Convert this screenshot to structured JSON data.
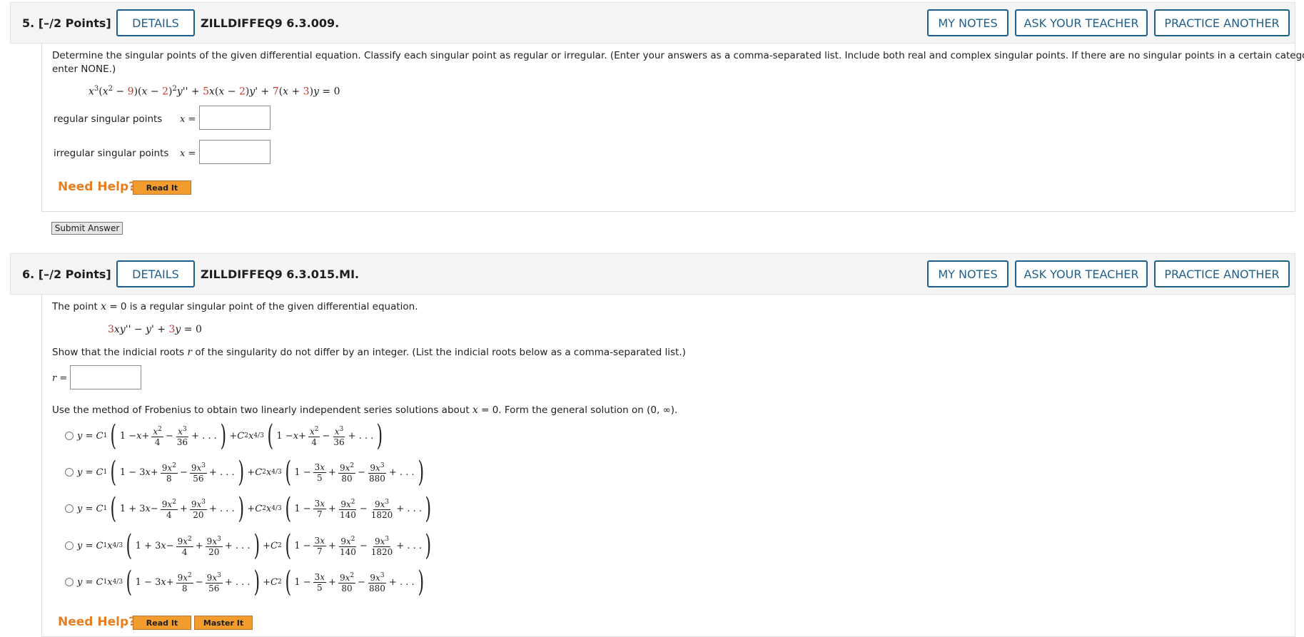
{
  "q5": {
    "number": "5.",
    "points": "[–/2 Points]",
    "details": "DETAILS",
    "id": "ZILLDIFFEQ9 6.3.009.",
    "my_notes": "MY NOTES",
    "ask_teacher": "ASK YOUR TEACHER",
    "practice": "PRACTICE ANOTHER",
    "instruction_1": "Determine the singular points of the given differential equation. Classify each singular point as regular or irregular. (Enter your answers as a comma-separated list. Include both real and complex singular points. If there are no singular points in a certain category,",
    "instruction_2": "enter NONE.)",
    "regular_label": "regular singular points",
    "irregular_label": "irregular singular points",
    "x_equals": "x =",
    "need_help": "Need Help?",
    "read_it": "Read It",
    "submit": "Submit Answer"
  },
  "q6": {
    "number": "6.",
    "points": "[–/2 Points]",
    "details": "DETAILS",
    "id": "ZILLDIFFEQ9 6.3.015.MI.",
    "my_notes": "MY NOTES",
    "ask_teacher": "ASK YOUR TEACHER",
    "practice": "PRACTICE ANOTHER",
    "line1_pre": "The point ",
    "line1_var": "x",
    "line1_post": " = 0 is a regular singular point of the given differential equation.",
    "line2_pre": "Show that the indicial roots ",
    "line2_var": "r",
    "line2_post": " of the singularity do not differ by an integer. (List the indicial roots below as a comma-separated list.)",
    "r_equals": "r =",
    "line3_pre": "Use the method of Frobenius to obtain two linearly independent series solutions about ",
    "line3_var": "x",
    "line3_post": " = 0. Form the general solution on (0, ∞).",
    "need_help": "Need Help?",
    "read_it": "Read It",
    "master_it": "Master It"
  },
  "colors": {
    "accent": "#1f5f8b",
    "help": "#e67e22",
    "red": "#c0392b"
  }
}
